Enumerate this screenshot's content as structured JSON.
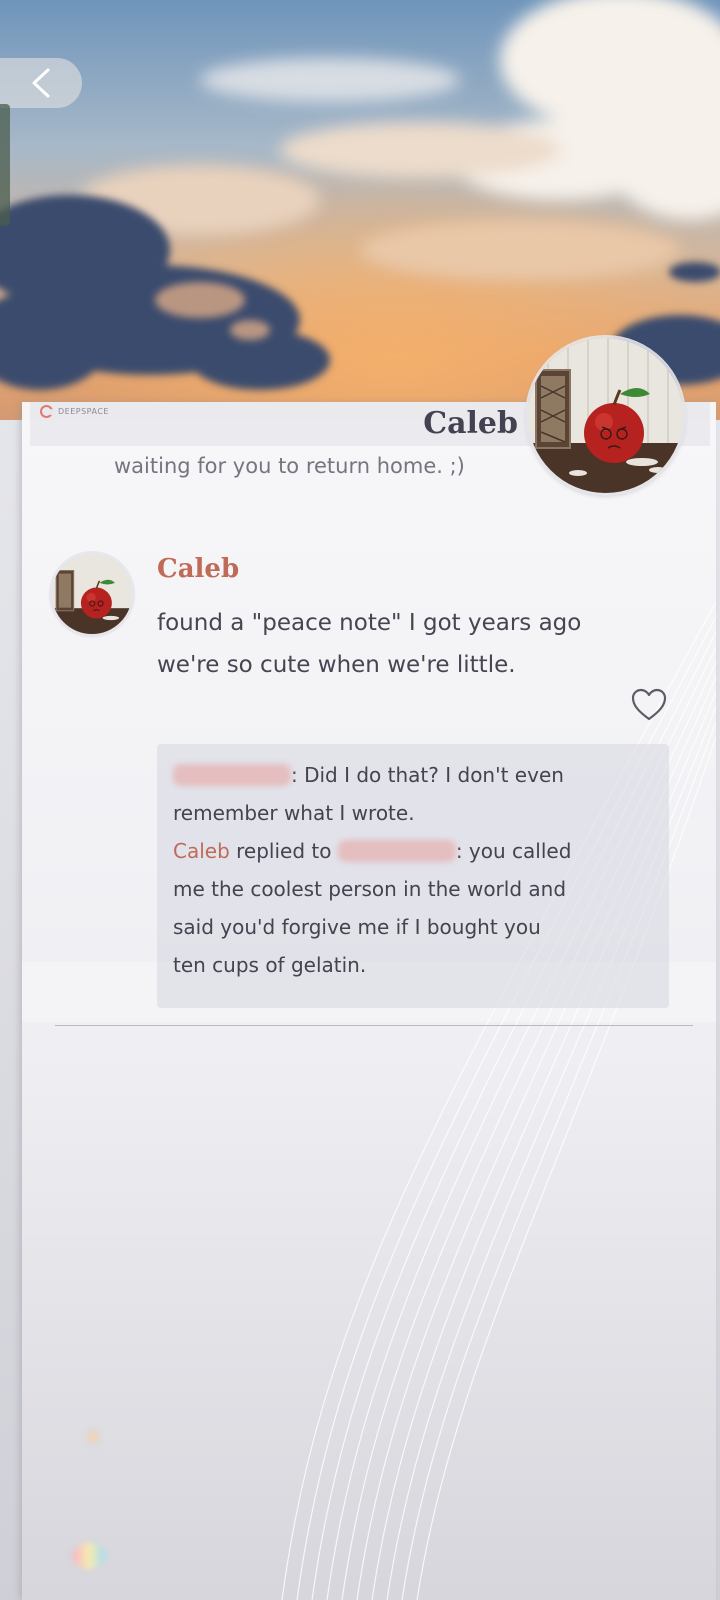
{
  "header": {
    "back_icon": "chevron-left-icon"
  },
  "profile": {
    "brand": "DEEPSPACE",
    "name": "Caleb",
    "status": "waiting for you to return home. ;)",
    "avatar_icon": "apple-avatar"
  },
  "post": {
    "author": "Caleb",
    "lines": [
      "found a \"peace note\" I got years ago",
      "we're so cute when we're little."
    ],
    "like_icon": "heart-outline-icon"
  },
  "comments": {
    "first": {
      "text_line1": ": Did I do that? I don't even",
      "text_line2": "remember what I wrote."
    },
    "reply": {
      "author": "Caleb",
      "replied_to": " replied to ",
      "text_line1": ": you called",
      "text_line2": "me the coolest person in the world and",
      "text_line3": "said you'd forgive me if I bought you",
      "text_line4": "ten cups of gelatin."
    }
  },
  "colors": {
    "accent": "#c06a58",
    "text": "#464552",
    "muted": "#757580"
  }
}
